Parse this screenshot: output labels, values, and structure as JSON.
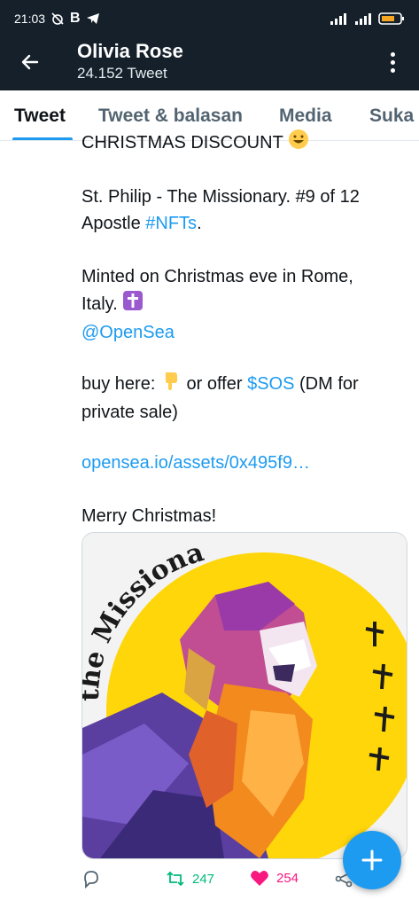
{
  "status_bar": {
    "time": "21:03",
    "left_icons": [
      "alarm-off-icon",
      "b-icon",
      "telegram-icon"
    ],
    "right_icons": [
      "signal-icon",
      "signal-icon",
      "battery-icon"
    ]
  },
  "header": {
    "name": "Olivia Rose",
    "tweet_count": "24.152 Tweet"
  },
  "tabs": [
    {
      "label": "Tweet",
      "active": true
    },
    {
      "label": "Tweet & balasan",
      "active": false
    },
    {
      "label": "Media",
      "active": false
    },
    {
      "label": "Suka",
      "active": false
    }
  ],
  "tweet": {
    "cut_line": "CHRISTMAS DISCOUNT",
    "p1_text": "St. Philip - The Missionary. #9 of 12",
    "p1_text2": "Apostle ",
    "p1_hashtag": "#NFTs",
    "p1_period": ".",
    "p2_line1": "Minted on Christmas eve in Rome,",
    "p2_line2": "Italy.",
    "p2_mention": "@OpenSea",
    "p3_buy": " buy here:",
    "p3_offer": " or offer ",
    "p3_cashtag": "$SOS",
    "p3_dm": " (DM for",
    "p3_line2": "private sale)",
    "p4_link": "opensea.io/assets/0x495f9…",
    "p5_text": "Merry Christmas!",
    "image_text": "the Missionary"
  },
  "actions": {
    "retweets": "247",
    "likes": "254"
  },
  "colors": {
    "header_bg": "#15202b",
    "accent": "#1d9bf0",
    "retweet": "#00ba7c",
    "like": "#f91880"
  }
}
